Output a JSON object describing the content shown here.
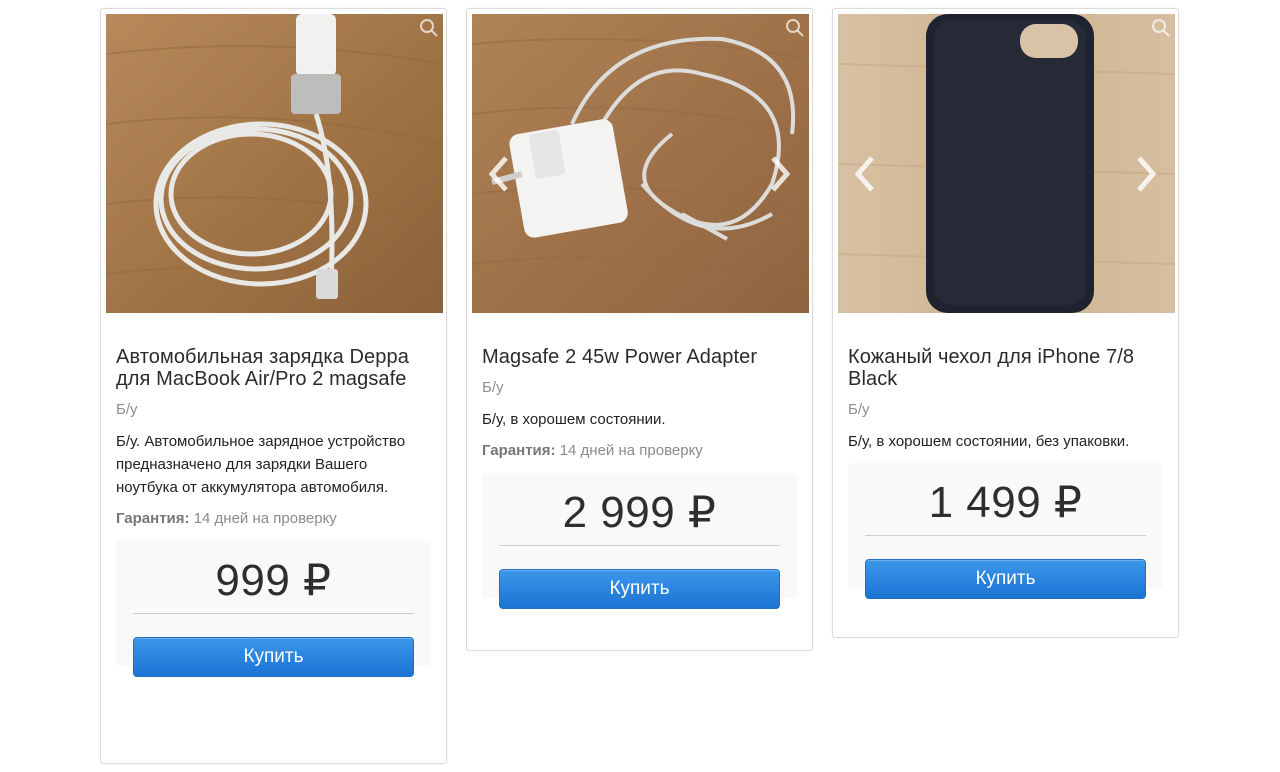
{
  "currency_sign": "₽",
  "products": [
    {
      "title": "Автомобильная зарядка Deppa для MacBook Air/Pro 2 magsafe",
      "condition": "Б/у",
      "description": "Б/у. Автомобильное зарядное устройство предназначено для зарядки Вашего ноутбука от аккумулятора автомобиля.",
      "warranty_label": "Гарантия:",
      "warranty_value": "14 дней на проверку",
      "price": "999 ₽",
      "buy_label": "Купить",
      "photo_icon": "car-charger-cable-photo",
      "has_arrows": false
    },
    {
      "title": "Magsafe 2 45w Power Adapter",
      "condition": "Б/у",
      "description": "Б/у, в хорошем состоянии.",
      "warranty_label": "Гарантия:",
      "warranty_value": "14 дней на проверку",
      "price": "2 999 ₽",
      "buy_label": "Купить",
      "photo_icon": "power-adapter-photo",
      "has_arrows": true
    },
    {
      "title": "Кожаный чехол для iPhone 7/8 Black",
      "condition": "Б/у",
      "description": "Б/у, в хорошем состоянии, без упаковки.",
      "price": "1 499 ₽",
      "buy_label": "Купить",
      "photo_icon": "phone-case-photo",
      "has_arrows": true
    }
  ],
  "colors": {
    "button_top": "#3c97ea",
    "button_bottom": "#1b73d3",
    "wood": "#a67a4d"
  }
}
